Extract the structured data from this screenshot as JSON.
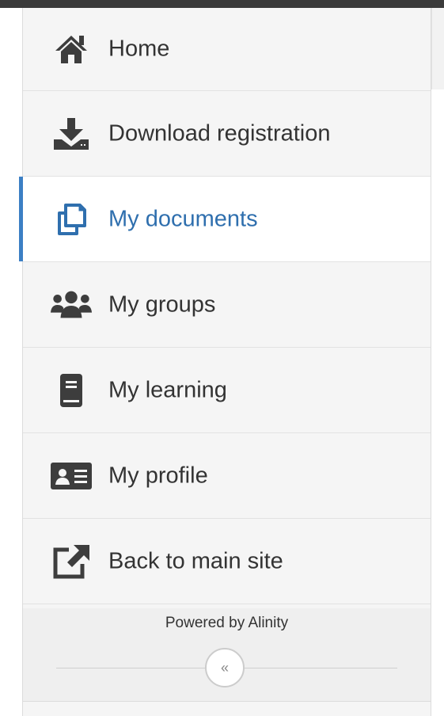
{
  "nav": {
    "items": [
      {
        "label": "Home",
        "icon": "home-icon"
      },
      {
        "label": "Download registration",
        "icon": "download-icon"
      },
      {
        "label": "My documents",
        "icon": "documents-icon",
        "active": true
      },
      {
        "label": "My groups",
        "icon": "groups-icon"
      },
      {
        "label": "My learning",
        "icon": "book-icon"
      },
      {
        "label": "My profile",
        "icon": "id-card-icon"
      },
      {
        "label": "Back to main site",
        "icon": "external-link-icon"
      }
    ]
  },
  "footer": {
    "powered_by": "Powered by Alinity",
    "collapse_glyph": "«"
  },
  "colors": {
    "accent": "#3c7fc4",
    "active_text": "#2f6fae",
    "icon": "#3d3d3d",
    "sidebar_bg": "#f5f5f5"
  }
}
